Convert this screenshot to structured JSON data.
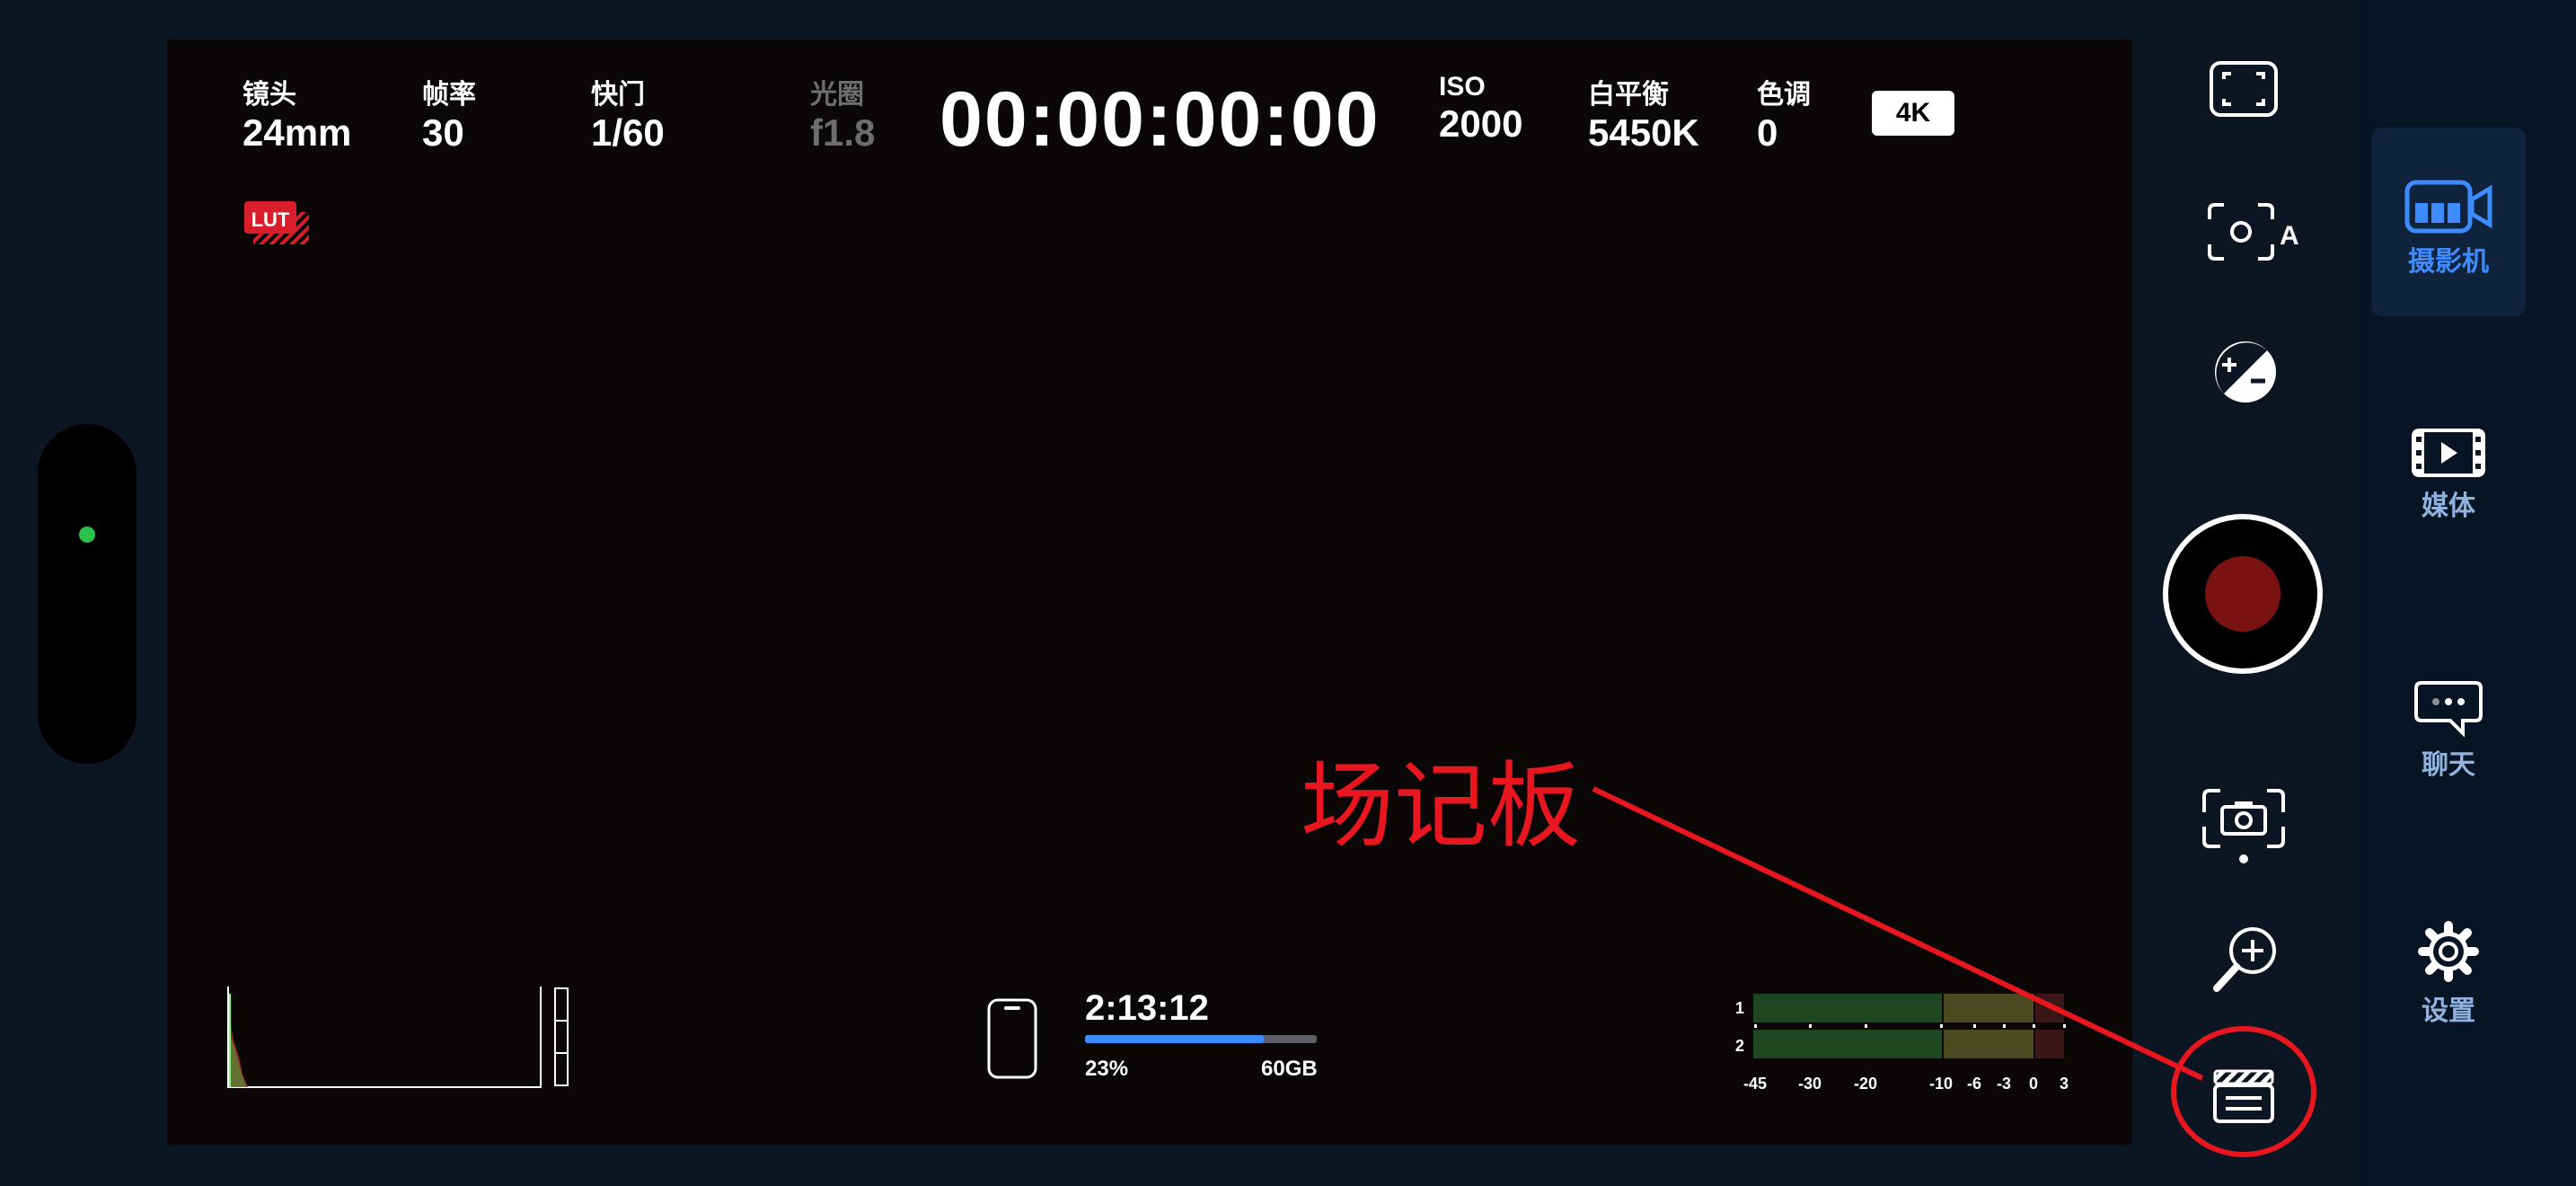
{
  "top_bar": {
    "lens": {
      "label": "镜头",
      "value": "24mm"
    },
    "fps": {
      "label": "帧率",
      "value": "30"
    },
    "shutter": {
      "label": "快门",
      "value": "1/60"
    },
    "iris": {
      "label": "光圈",
      "value": "f1.8"
    },
    "timecode": "00:00:00:00",
    "iso": {
      "label": "ISO",
      "value": "2000"
    },
    "white_balance": {
      "label": "白平衡",
      "value": "5450K"
    },
    "tint": {
      "label": "色调",
      "value": "0"
    },
    "resolution_badge": "4K"
  },
  "lut_badge": "LUT",
  "storage": {
    "remaining_time": "2:13:12",
    "percent_label": "23%",
    "capacity": "60GB",
    "fill_fraction": 0.77
  },
  "audio_meter": {
    "channels": [
      "1",
      "2"
    ],
    "scale": [
      "-45",
      "-30",
      "-20",
      "-10",
      "-6",
      "-3",
      "0",
      "3"
    ]
  },
  "right_controls": [
    "fullscreen-icon",
    "auto-focus-icon",
    "exposure-comp-icon",
    "record-button",
    "flip-camera-icon",
    "zoom-icon",
    "slate-icon"
  ],
  "side_nav": {
    "items": [
      {
        "label": "摄影机",
        "icon": "video-camera-icon",
        "active": true
      },
      {
        "label": "媒体",
        "icon": "media-icon",
        "active": false
      },
      {
        "label": "聊天",
        "icon": "chat-icon",
        "active": false
      },
      {
        "label": "设置",
        "icon": "settings-gear-icon",
        "active": false
      }
    ]
  },
  "annotation": {
    "text": "场记板",
    "color": "#e8161e"
  },
  "colors": {
    "accent": "#3d8cff",
    "record": "#7a1212",
    "status_dot": "#29c24a"
  }
}
